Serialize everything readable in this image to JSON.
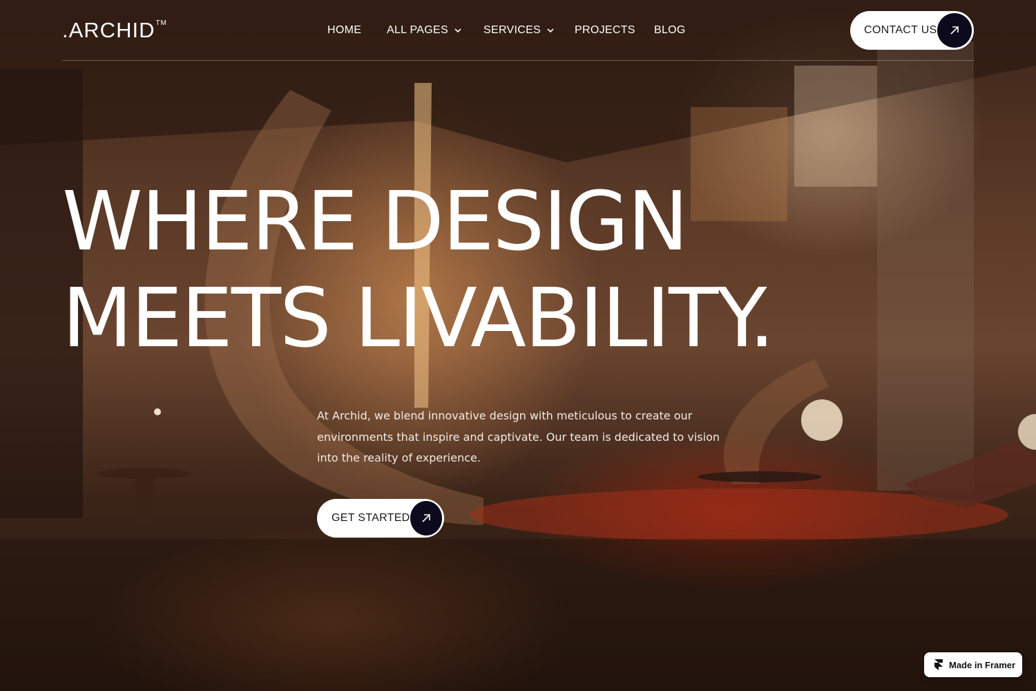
{
  "header": {
    "logo": ".ARCHID",
    "logo_mark": "TM",
    "nav": {
      "home": "HOME",
      "all_pages": "ALL PAGES",
      "services": "SERVICES",
      "projects": "PROJECTS",
      "blog": "BLOG"
    },
    "contact_label": "CONTACT US"
  },
  "hero": {
    "headline_line1": "WHERE DESIGN",
    "headline_line2": "MEETS LIVABILITY.",
    "intro": "At Archid, we blend innovative design with meticulous to create our environments that inspire and captivate. Our team is dedicated to vision into the reality of experience.",
    "cta_label": "GET STARTED"
  },
  "badge": {
    "label": "Made in Framer"
  },
  "colors": {
    "button_dark": "#0c0a1c",
    "text_light": "#ffffff"
  }
}
